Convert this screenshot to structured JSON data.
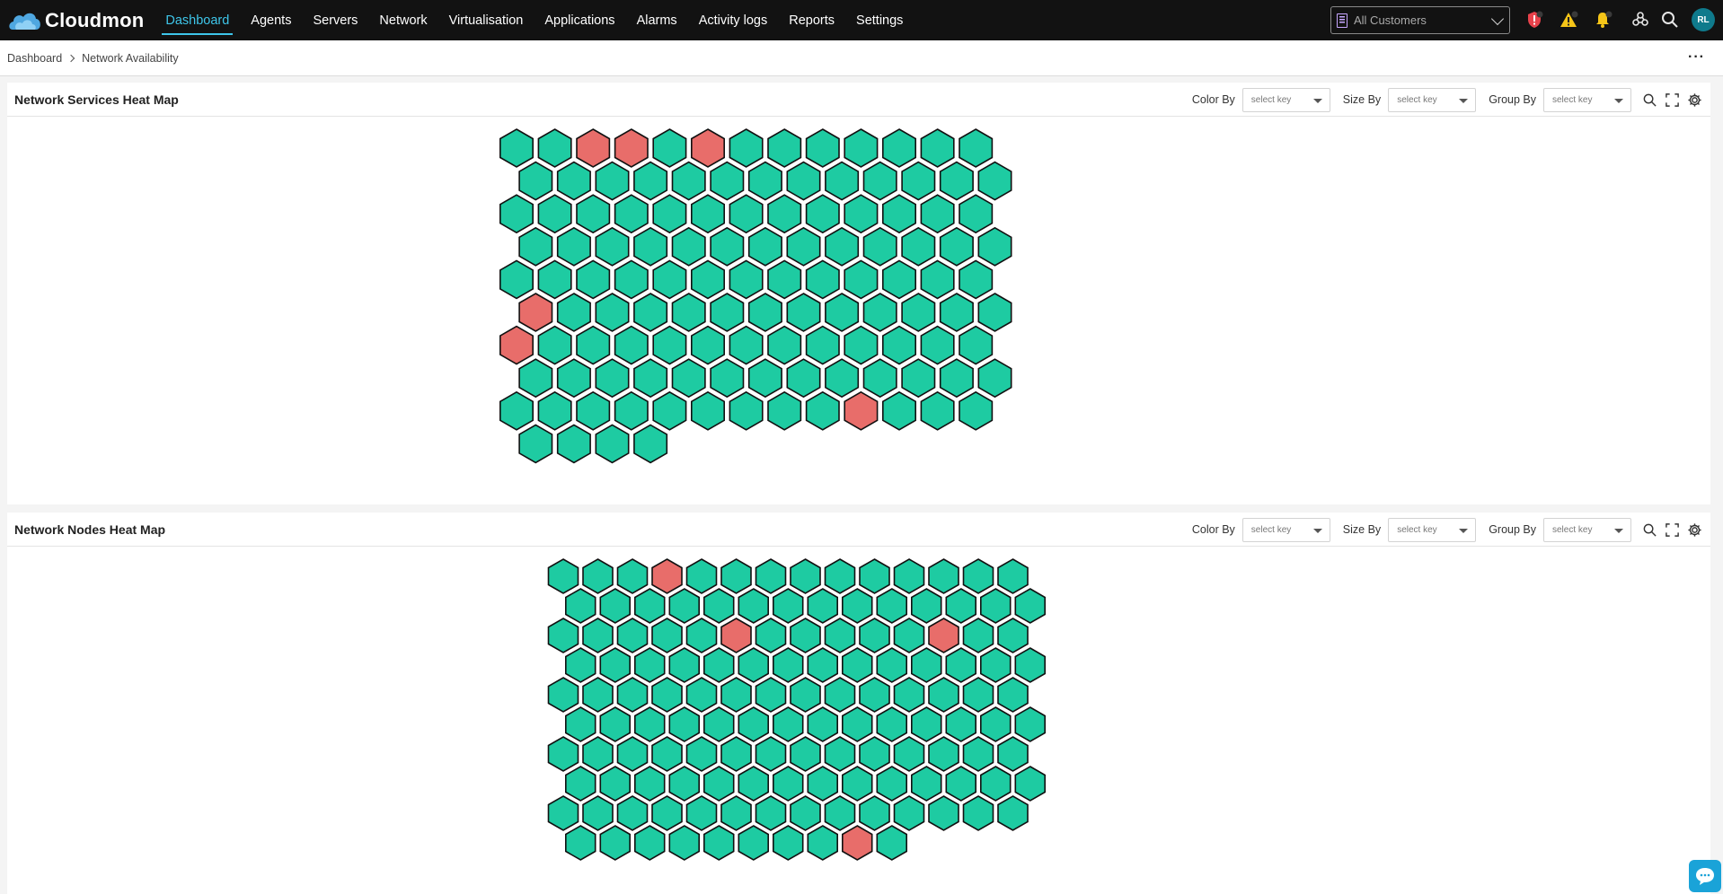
{
  "app": {
    "brand": "Cloudmon"
  },
  "nav": {
    "items": [
      {
        "label": "Dashboard",
        "active": true
      },
      {
        "label": "Agents"
      },
      {
        "label": "Servers"
      },
      {
        "label": "Network"
      },
      {
        "label": "Virtualisation"
      },
      {
        "label": "Applications"
      },
      {
        "label": "Alarms"
      },
      {
        "label": "Activity logs"
      },
      {
        "label": "Reports"
      },
      {
        "label": "Settings"
      }
    ],
    "customer_select": "All Customers",
    "icons": [
      "shield-alert-icon",
      "warning-icon",
      "bell-icon",
      "integrations-icon",
      "search-icon"
    ],
    "avatar_initials": "RL"
  },
  "breadcrumb": {
    "items": [
      "Dashboard",
      "Network Availability"
    ]
  },
  "colors": {
    "ok": "#1ecba2",
    "down": "#e86d6a",
    "accent": "#3ec6ea"
  },
  "panels": [
    {
      "title": "Network Services Heat Map",
      "color_by_label": "Color By",
      "color_by_value": "select key",
      "size_by_label": "Size By",
      "size_by_value": "select key",
      "group_by_label": "Group By",
      "group_by_value": "select key",
      "rows": [
        {
          "count": 13,
          "offset": false
        },
        {
          "count": 13,
          "offset": true
        },
        {
          "count": 13,
          "offset": false
        },
        {
          "count": 13,
          "offset": true
        },
        {
          "count": 13,
          "offset": false
        },
        {
          "count": 13,
          "offset": true
        },
        {
          "count": 13,
          "offset": false
        },
        {
          "count": 13,
          "offset": true
        },
        {
          "count": 13,
          "offset": false
        },
        {
          "count": 4,
          "offset": true
        }
      ],
      "down": [
        [
          0,
          2
        ],
        [
          0,
          3
        ],
        [
          0,
          5
        ],
        [
          5,
          0
        ],
        [
          6,
          0
        ],
        [
          8,
          9
        ]
      ]
    },
    {
      "title": "Network Nodes Heat Map",
      "color_by_label": "Color By",
      "color_by_value": "select key",
      "size_by_label": "Size By",
      "size_by_value": "select key",
      "group_by_label": "Group By",
      "group_by_value": "select key",
      "rows": [
        {
          "count": 14,
          "offset": false
        },
        {
          "count": 14,
          "offset": true
        },
        {
          "count": 14,
          "offset": false
        },
        {
          "count": 14,
          "offset": true
        },
        {
          "count": 14,
          "offset": false
        },
        {
          "count": 14,
          "offset": true
        },
        {
          "count": 14,
          "offset": false
        },
        {
          "count": 14,
          "offset": true
        },
        {
          "count": 14,
          "offset": false
        },
        {
          "count": 10,
          "offset": true
        }
      ],
      "down": [
        [
          0,
          3
        ],
        [
          2,
          5
        ],
        [
          2,
          11
        ],
        [
          9,
          8
        ]
      ]
    }
  ]
}
